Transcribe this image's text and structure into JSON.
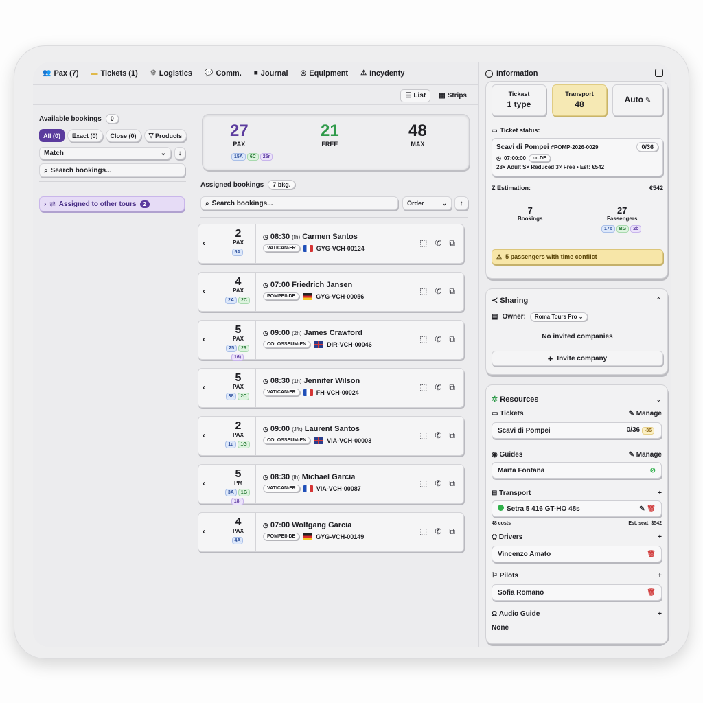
{
  "tabs": [
    {
      "icon": "👥",
      "label": "Pax (7)"
    },
    {
      "icon": "▬",
      "label": "Tickets (1)"
    },
    {
      "icon": "⚙",
      "label": "Logistics"
    },
    {
      "icon": "💬",
      "label": "Comm."
    },
    {
      "icon": "■",
      "label": "Journal"
    },
    {
      "icon": "◎",
      "label": "Equipment"
    },
    {
      "icon": "⚠",
      "label": "Incydenty"
    }
  ],
  "view": {
    "list": "List",
    "strips": "Strips"
  },
  "available": {
    "title": "Available bookings",
    "count": "0",
    "filters": [
      "All (0)",
      "Exact (0)",
      "Close (0)",
      "Products"
    ],
    "match": "Match",
    "search_placeholder": "Search bookings...",
    "assigned_other": "Assigned to other tours",
    "assigned_other_count": "2"
  },
  "summary": {
    "pax": "27",
    "pax_label": "PAX",
    "free": "21",
    "free_label": "FREE",
    "max": "48",
    "max_label": "MAX",
    "chips": [
      "15A",
      "6C",
      "25r"
    ]
  },
  "assigned": {
    "title": "Assigned bookings",
    "count": "7 bkg.",
    "search_placeholder": "Search bookings...",
    "order": "Order"
  },
  "bookings": [
    {
      "pax": "2",
      "label": "PAX",
      "chips": [
        "5A"
      ],
      "time": "08:30",
      "lang": "(fh)",
      "name": "Carmen Santos",
      "tour": "VATICAN-FR",
      "flag": "fr",
      "code": "GYG-VCH-00124"
    },
    {
      "pax": "4",
      "label": "PAX",
      "chips": [
        "2A",
        "2C"
      ],
      "time": "07:00",
      "lang": "",
      "name": "Friedrich Jansen",
      "tour": "POMPEII-DE",
      "flag": "de",
      "code": "GYG-VCH-00056"
    },
    {
      "pax": "5",
      "label": "PAX",
      "chips": [
        "25",
        "26",
        "16)"
      ],
      "time": "09:00",
      "lang": "(2h)",
      "name": "James Crawford",
      "tour": "COLOSSEUM-EN",
      "flag": "uk",
      "code": "DIR-VCH-00046"
    },
    {
      "pax": "5",
      "label": "PAX",
      "chips": [
        "38",
        "2C"
      ],
      "time": "08:30",
      "lang": "(1h)",
      "name": "Jennifer Wilson",
      "tour": "VATICAN-FR",
      "flag": "fr",
      "code": "FH-VCH-00024"
    },
    {
      "pax": "2",
      "label": "PAX",
      "chips": [
        "1d",
        "1G"
      ],
      "time": "09:00",
      "lang": "(J/k)",
      "name": "Laurent Santos",
      "tour": "COLOSSEUM-EN",
      "flag": "uk",
      "code": "VIA-VCH-00003"
    },
    {
      "pax": "5",
      "label": "PM",
      "chips": [
        "3A",
        "1G",
        "18r"
      ],
      "time": "08:30",
      "lang": "(lh)",
      "name": "Michael Garcia",
      "tour": "VATICAN-FR",
      "flag": "fr",
      "code": "VIA-VCH-00087"
    },
    {
      "pax": "4",
      "label": "PAX",
      "chips": [
        "4A"
      ],
      "time": "07:00",
      "lang": "",
      "name": "Wolfgang Garcia",
      "tour": "POMPEII-DE",
      "flag": "de",
      "code": "GYG-VCH-00149"
    }
  ],
  "info": {
    "title": "Information",
    "tabs": [
      {
        "top": "Tickast",
        "bottom": "1 type"
      },
      {
        "top": "Transport",
        "bottom": "48"
      },
      {
        "top": "Auto",
        "bottom": ""
      }
    ],
    "ticket_status_label": "Ticket status:",
    "ticket_name": "Scavi di Pompei",
    "ticket_code": "#POMP-2026-0029",
    "ticket_count": "0/36",
    "ticket_time": "07:00:00",
    "ticket_tag": "oc.DE",
    "ticket_breakdown": "28× Adult  S× Reduced  3× Free  •  Est: €542",
    "estimation_label": "Z Estimation:",
    "estimation_value": "€542",
    "bookings_n": "7",
    "bookings_label": "Bookings",
    "passengers_n": "27",
    "passengers_label": "Fassengers",
    "passengers_chips": [
      "17s",
      "BG",
      "2b"
    ],
    "warning": "5 passengers with time conflict"
  },
  "sharing": {
    "title": "Sharing",
    "owner_label": "Owner:",
    "owner": "Roma Tours Pro",
    "empty": "No invited companies",
    "invite": "Invite company"
  },
  "resources": {
    "title": "Resources",
    "tickets_label": "Tickets",
    "manage": "Manage",
    "ticket_item": "Scavi di Pompei",
    "ticket_item_count": "0/36",
    "ticket_item_badge": "-36",
    "guides_label": "Guides",
    "guide": "Marta Fontana",
    "transport_label": "Transport",
    "vehicle": "Setra 5 416 GT-HO 48s",
    "transport_costs": "48 costs",
    "transport_est": "Est. seat: $542",
    "drivers_label": "Drivers",
    "driver": "Vincenzo Amato",
    "pilots_label": "Pilots",
    "pilot": "Sofia Romano",
    "audio_label": "Audio Guide",
    "audio_value": "None"
  },
  "colors": {
    "accent_purple": "#5b3b9e",
    "free_green": "#2f9a4a",
    "warning_yellow": "#f7e6a8",
    "transport_highlight": "#f6e9b4"
  }
}
